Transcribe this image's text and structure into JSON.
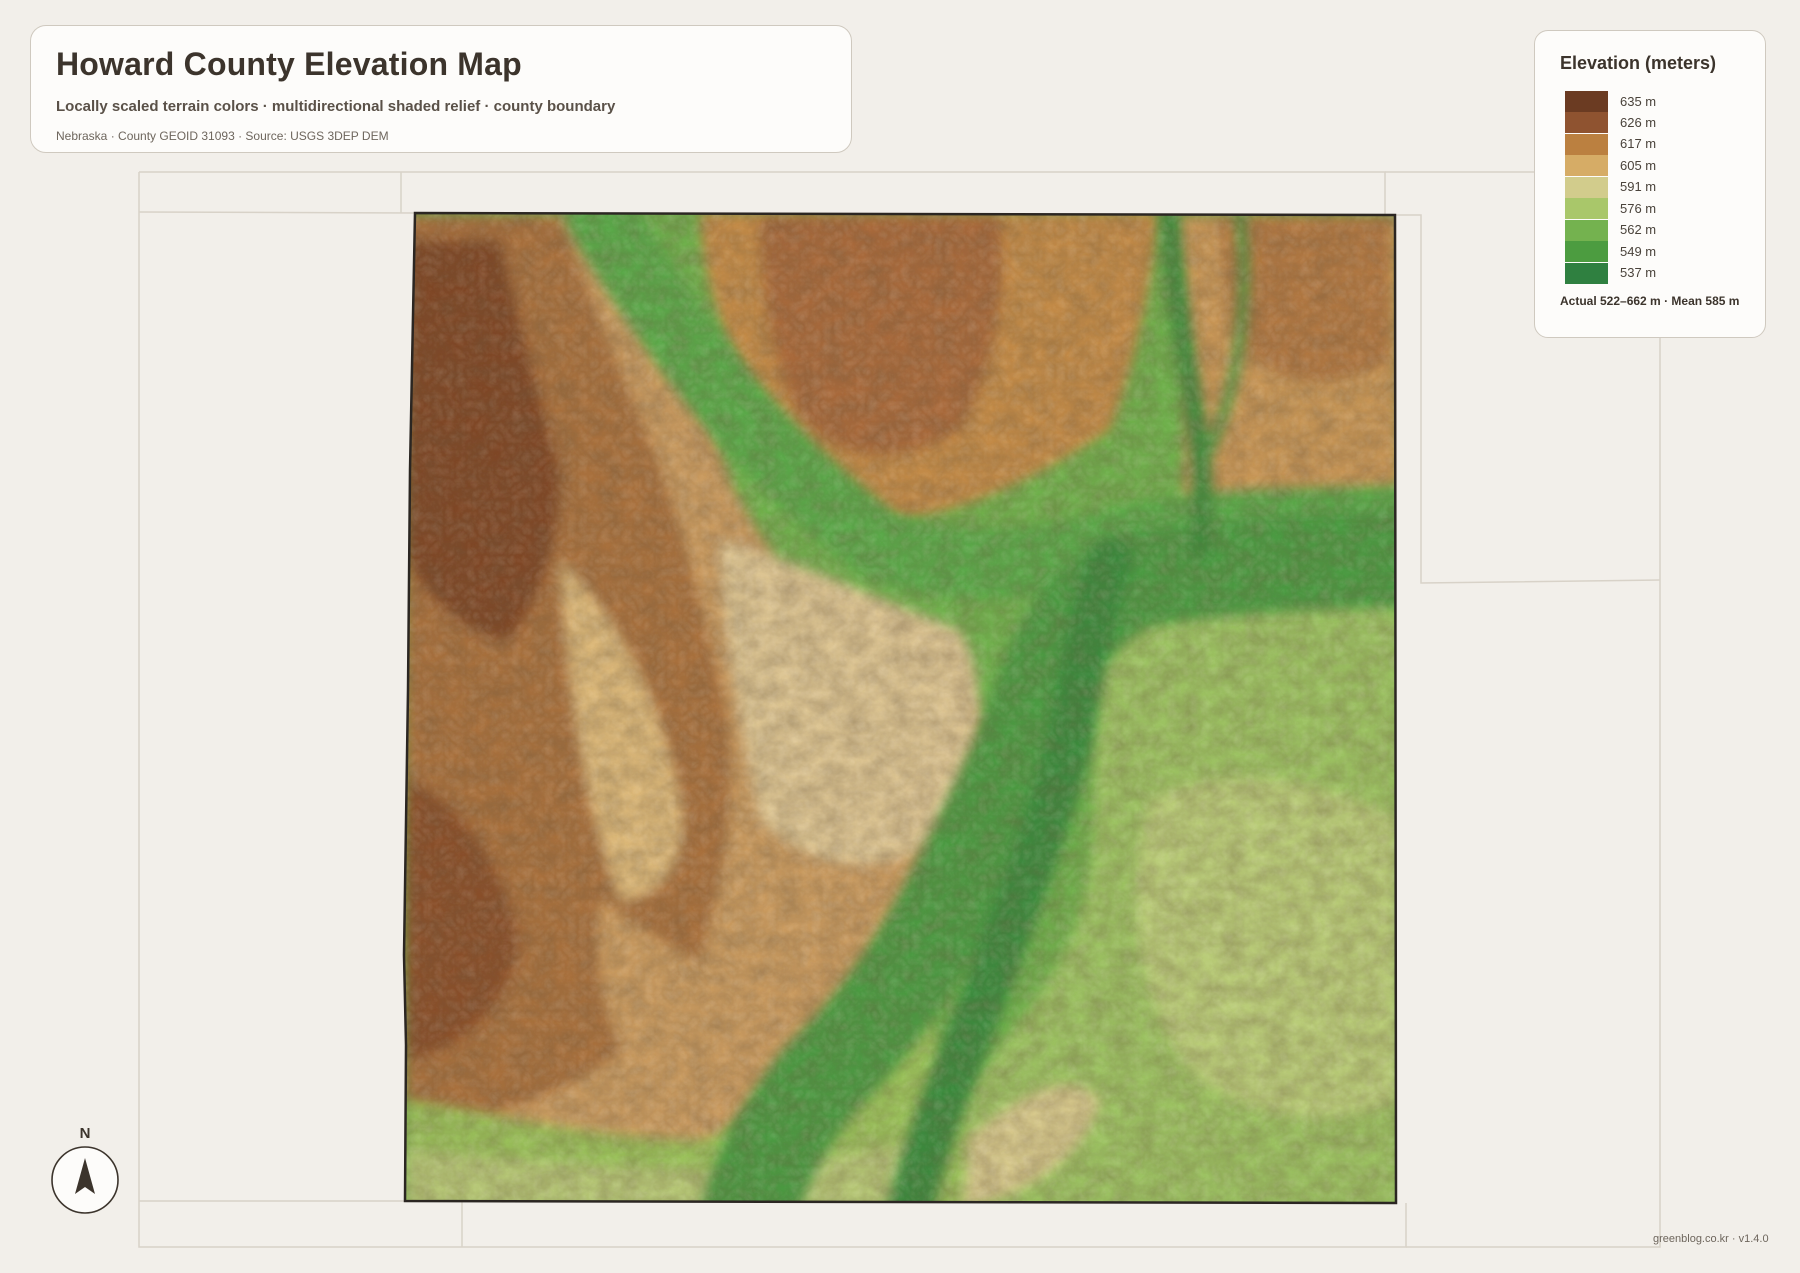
{
  "header": {
    "title": "Howard County Elevation Map",
    "subtitle": "Locally scaled terrain colors · multidirectional shaded relief · county boundary",
    "source": "Nebraska · County GEOID 31093 · Source: USGS 3DEP DEM"
  },
  "legend": {
    "title": "Elevation (meters)",
    "items": [
      {
        "label": "635 m",
        "color": "#6b3b22"
      },
      {
        "label": "626 m",
        "color": "#8f5330"
      },
      {
        "label": "617 m",
        "color": "#bb8040"
      },
      {
        "label": "605 m",
        "color": "#d6ac66"
      },
      {
        "label": "591 m",
        "color": "#d2cc8c"
      },
      {
        "label": "576 m",
        "color": "#a9c76a"
      },
      {
        "label": "562 m",
        "color": "#74b24f"
      },
      {
        "label": "549 m",
        "color": "#4c9c40"
      },
      {
        "label": "537 m",
        "color": "#2f8040"
      }
    ],
    "summary": "Actual 522–662 m · Mean 585 m"
  },
  "compass": {
    "label": "N"
  },
  "credit": "greenblog.co.kr · v1.4.0",
  "colors": {
    "background": "#f2efea",
    "card": "#fdfcfa",
    "boundary": "#2b2622",
    "neighbor_lines": "#d8d2c8"
  }
}
